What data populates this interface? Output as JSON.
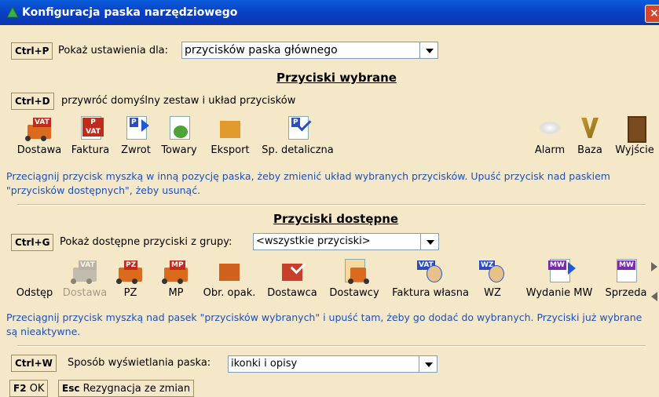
{
  "window": {
    "title": "Konfiguracja paska narzędziowego",
    "close_glyph": "×"
  },
  "show_settings": {
    "shortcut": "Ctrl+P",
    "label": "Pokaż ustawienia dla:",
    "value": "przycisków paska głównego"
  },
  "selected_section": {
    "heading": "Przyciski wybrane",
    "restore": {
      "shortcut": "Ctrl+D",
      "label": "przywróć domyślny zestaw i układ przycisków"
    },
    "buttons": [
      {
        "label": "Dostawa",
        "icon": "truck-vat-icon"
      },
      {
        "label": "Faktura",
        "icon": "invoice-vat-icon"
      },
      {
        "label": "Zwrot",
        "icon": "return-icon"
      },
      {
        "label": "Towary",
        "icon": "goods-icon"
      },
      {
        "label": "Eksport",
        "icon": "export-icon"
      },
      {
        "label": "Sp. detaliczna",
        "icon": "retail-sale-icon"
      },
      {
        "label": "Alarm",
        "icon": "alarm-icon"
      },
      {
        "label": "Baza",
        "icon": "database-icon"
      },
      {
        "label": "Wyjście",
        "icon": "exit-icon"
      }
    ],
    "info": "Przeciągnij przycisk myszką w inną pozycję paska, żeby zmienić układ wybranych przycisków. Upuść przycisk nad paskiem \"przycisków dostępnych\", żeby usunąć."
  },
  "available_section": {
    "heading": "Przyciski dostępne",
    "group": {
      "shortcut": "Ctrl+G",
      "label": "Pokaż dostępne przyciski z grupy:",
      "value": "<wszystkie przyciski>"
    },
    "buttons": [
      {
        "label": "Odstęp",
        "icon": "spacer-icon",
        "disabled": false
      },
      {
        "label": "Dostawa",
        "icon": "truck-vat-icon",
        "disabled": true
      },
      {
        "label": "PZ",
        "icon": "truck-pz-icon",
        "disabled": false
      },
      {
        "label": "MP",
        "icon": "truck-mp-icon",
        "disabled": false
      },
      {
        "label": "Obr. opak.",
        "icon": "packaging-icon",
        "disabled": false
      },
      {
        "label": "Dostawca",
        "icon": "supplier-icon",
        "disabled": false
      },
      {
        "label": "Dostawcy",
        "icon": "suppliers-icon",
        "disabled": false
      },
      {
        "label": "Faktura własna",
        "icon": "own-invoice-icon",
        "disabled": false
      },
      {
        "label": "WZ",
        "icon": "wz-icon",
        "disabled": false
      },
      {
        "label": "Wydanie MW",
        "icon": "mw-release-icon",
        "disabled": false
      },
      {
        "label": "Sprzeda",
        "icon": "mw-sale-icon",
        "disabled": false
      }
    ],
    "info": "Przeciągnij przycisk myszką nad pasek \"przycisków wybranych\" i upuść tam, żeby go dodać do wybranych. Przyciski już wybrane są nieaktywne."
  },
  "display_mode": {
    "shortcut": "Ctrl+W",
    "label": "Sposób wyświetlania paska:",
    "value": "ikonki i opisy"
  },
  "footer": {
    "ok": {
      "key": "F2",
      "label": "OK"
    },
    "cancel": {
      "key": "Esc",
      "label": "Rezygnacja ze zmian"
    }
  },
  "colors": {
    "panel": "#F5E8C8",
    "info_text": "#1F4FB5",
    "titlebar": "#0A3FC4"
  }
}
